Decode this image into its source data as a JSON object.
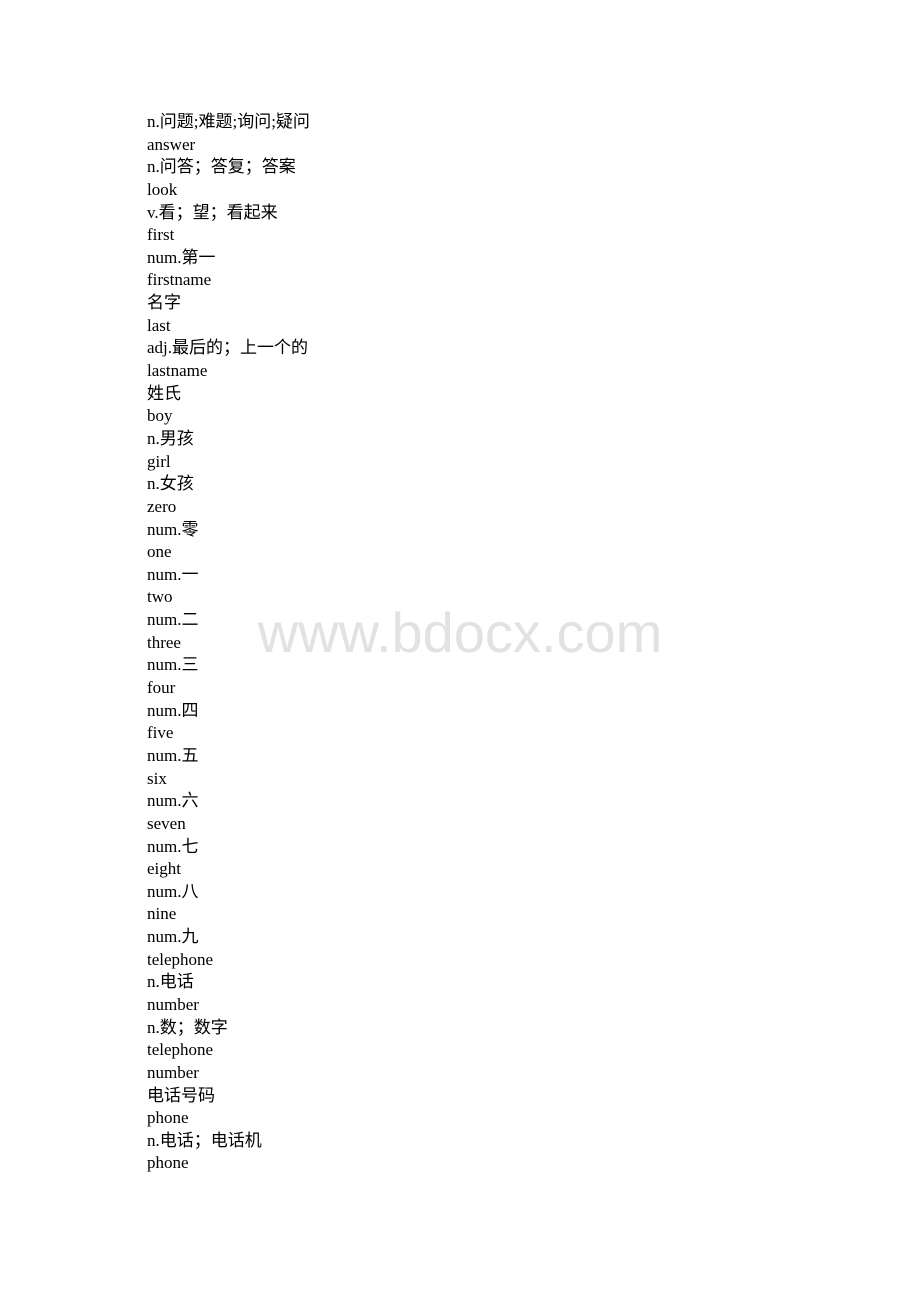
{
  "document": {
    "lines": [
      "n.问题;难题;询问;疑问",
      "answer",
      "n.问答；答复；答案",
      "look",
      "v.看；望；看起来",
      "first",
      "num.第一",
      "firstname",
      "名字",
      "last",
      "adj.最后的；上一个的",
      "lastname",
      "姓氏",
      "boy",
      "n.男孩",
      "girl",
      "n.女孩",
      "zero",
      "num.零",
      "one",
      "num.一",
      "two",
      "num.二",
      "three",
      "num.三",
      "four",
      "num.四",
      "five",
      "num.五",
      "six",
      "num.六",
      "seven",
      "num.七",
      "eight",
      "num.八",
      "nine",
      "num.九",
      "telephone",
      "n.电话",
      "number",
      "n.数；数字",
      "telephone",
      "number",
      "电话号码",
      "phone",
      "n.电话；电话机",
      "phone"
    ]
  },
  "watermark": {
    "text": "www.bdocx.com",
    "color": "#e2e2e2"
  }
}
